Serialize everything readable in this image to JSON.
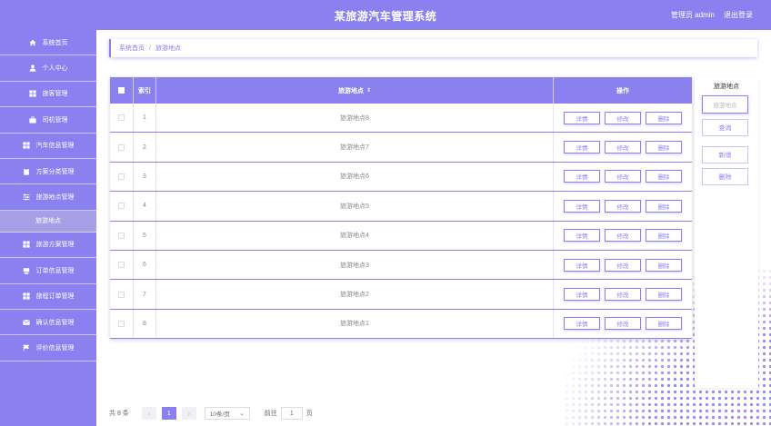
{
  "header": {
    "title": "某旅游汽车管理系统",
    "user": "管理员 admin",
    "logout": "退出登录"
  },
  "sidebar": {
    "items": [
      {
        "label": "系统首页",
        "icon": "home-icon"
      },
      {
        "label": "个人中心",
        "icon": "user-icon"
      },
      {
        "label": "旅客管理",
        "icon": "grid-icon"
      },
      {
        "label": "司机管理",
        "icon": "briefcase-icon"
      },
      {
        "label": "汽车信息管理",
        "icon": "grid-icon"
      },
      {
        "label": "方案分类管理",
        "icon": "clipboard-icon"
      },
      {
        "label": "旅游地点管理",
        "icon": "sliders-icon"
      },
      {
        "label": "旅游地点",
        "sub": true
      },
      {
        "label": "旅游方案管理",
        "icon": "grid-icon"
      },
      {
        "label": "订单信息管理",
        "icon": "storage-icon"
      },
      {
        "label": "旅程订单管理",
        "icon": "grid-icon"
      },
      {
        "label": "确认信息管理",
        "icon": "mail-icon"
      },
      {
        "label": "评价信息管理",
        "icon": "flag-icon"
      }
    ]
  },
  "breadcrumb": {
    "home": "系统首页",
    "separator": "/",
    "current": "旅游地点"
  },
  "table": {
    "columns": {
      "index": "索引",
      "name": "旅游地点",
      "ops": "操作"
    },
    "rows": [
      {
        "index": "1",
        "name": "旅游地点8"
      },
      {
        "index": "2",
        "name": "旅游地点7"
      },
      {
        "index": "3",
        "name": "旅游地点6"
      },
      {
        "index": "4",
        "name": "旅游地点5"
      },
      {
        "index": "5",
        "name": "旅游地点4"
      },
      {
        "index": "6",
        "name": "旅游地点3"
      },
      {
        "index": "7",
        "name": "旅游地点2"
      },
      {
        "index": "8",
        "name": "旅游地点1"
      }
    ],
    "actions": {
      "detail": "详情",
      "edit": "修改",
      "delete": "删除"
    }
  },
  "search": {
    "label": "旅游地点",
    "placeholder": "旅游地点",
    "query": "查询",
    "add": "新增",
    "delete": "删除"
  },
  "pager": {
    "total": "共 8 条",
    "prev": "‹",
    "page": "1",
    "next": "›",
    "size": "10条/页",
    "goto": "前往",
    "goto_value": "1",
    "unit": "页"
  },
  "colors": {
    "accent": "#8a80f0"
  }
}
